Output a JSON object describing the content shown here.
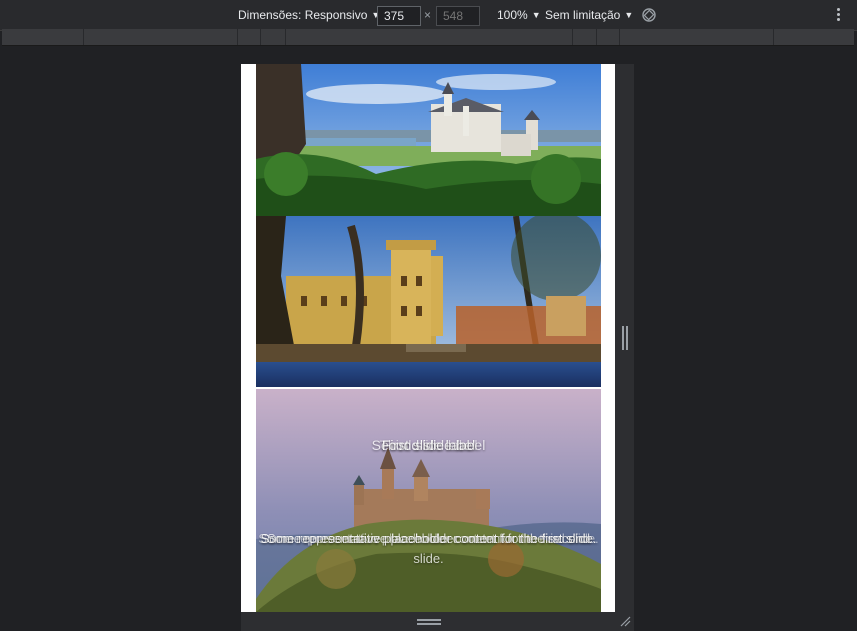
{
  "toolbar": {
    "dimensions_label": "Dimensões: Responsivo",
    "width_value": "375",
    "times_symbol": "×",
    "height_placeholder": "548",
    "zoom_label": "100%",
    "throttle_label": "Sem limitação",
    "icons": {
      "rotate": "rotate-icon",
      "more": "more-vert-icon",
      "dropdown": "triangle-down-icon"
    }
  },
  "carousel": {
    "slides": [
      {
        "caption_title": "First slide label",
        "caption_text": "Some representative placeholder content for the first slide."
      },
      {
        "caption_title": "Second slide label",
        "caption_text": "Some representative placeholder content for the second slide."
      },
      {
        "caption_title": "Third slide label",
        "caption_text": "Some representative placeholder content for the third slide."
      }
    ]
  },
  "colors": {
    "background": "#202124",
    "toolbar": "#292a2d",
    "text": "#e8eaed"
  }
}
